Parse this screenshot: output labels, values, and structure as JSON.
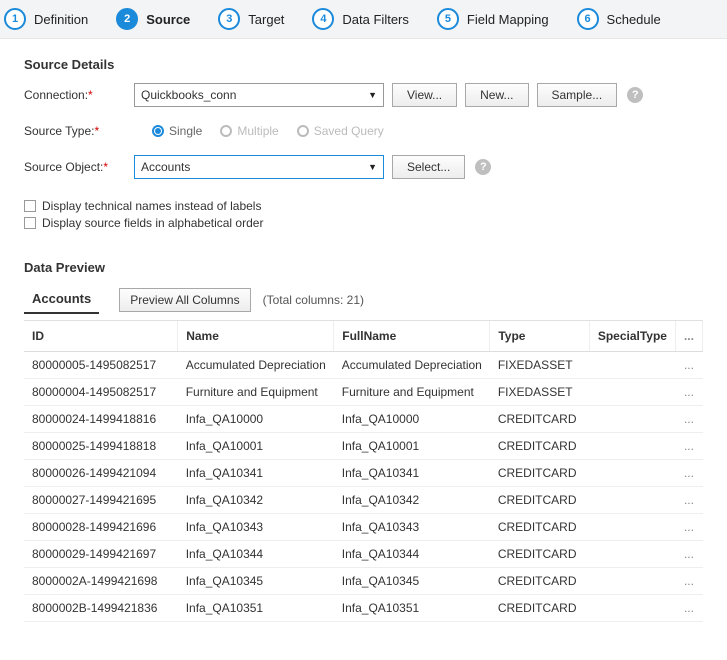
{
  "stepper": [
    {
      "num": "1",
      "label": "Definition"
    },
    {
      "num": "2",
      "label": "Source"
    },
    {
      "num": "3",
      "label": "Target"
    },
    {
      "num": "4",
      "label": "Data Filters"
    },
    {
      "num": "5",
      "label": "Field Mapping"
    },
    {
      "num": "6",
      "label": "Schedule"
    }
  ],
  "activeStep": 2,
  "sectionTitle": "Source Details",
  "labels": {
    "connection": "Connection:",
    "sourceType": "Source Type:",
    "sourceObject": "Source Object:"
  },
  "connection": {
    "value": "Quickbooks_conn"
  },
  "buttons": {
    "view": "View...",
    "new": "New...",
    "sample": "Sample...",
    "select": "Select...",
    "previewAll": "Preview All Columns"
  },
  "sourceType": {
    "options": [
      {
        "label": "Single",
        "checked": true,
        "disabled": false
      },
      {
        "label": "Multiple",
        "checked": false,
        "disabled": true
      },
      {
        "label": "Saved Query",
        "checked": false,
        "disabled": true
      }
    ]
  },
  "sourceObject": {
    "value": "Accounts"
  },
  "checkboxes": {
    "technical": "Display technical names instead of labels",
    "alphabetical": "Display source fields in alphabetical order"
  },
  "preview": {
    "title": "Data Preview",
    "tab": "Accounts",
    "totalColumns": "(Total columns: 21)",
    "columns": [
      "ID",
      "Name",
      "FullName",
      "Type",
      "SpecialType"
    ],
    "rows": [
      {
        "id": "80000005-1495082517",
        "name": "Accumulated Depreciation",
        "full": "Accumulated Depreciation",
        "type": "FIXEDASSET",
        "st": ""
      },
      {
        "id": "80000004-1495082517",
        "name": "Furniture and Equipment",
        "full": "Furniture and Equipment",
        "type": "FIXEDASSET",
        "st": ""
      },
      {
        "id": "80000024-1499418816",
        "name": "Infa_QA10000",
        "full": "Infa_QA10000",
        "type": "CREDITCARD",
        "st": ""
      },
      {
        "id": "80000025-1499418818",
        "name": "Infa_QA10001",
        "full": "Infa_QA10001",
        "type": "CREDITCARD",
        "st": ""
      },
      {
        "id": "80000026-1499421094",
        "name": "Infa_QA10341",
        "full": "Infa_QA10341",
        "type": "CREDITCARD",
        "st": ""
      },
      {
        "id": "80000027-1499421695",
        "name": "Infa_QA10342",
        "full": "Infa_QA10342",
        "type": "CREDITCARD",
        "st": ""
      },
      {
        "id": "80000028-1499421696",
        "name": "Infa_QA10343",
        "full": "Infa_QA10343",
        "type": "CREDITCARD",
        "st": ""
      },
      {
        "id": "80000029-1499421697",
        "name": "Infa_QA10344",
        "full": "Infa_QA10344",
        "type": "CREDITCARD",
        "st": ""
      },
      {
        "id": "8000002A-1499421698",
        "name": "Infa_QA10345",
        "full": "Infa_QA10345",
        "type": "CREDITCARD",
        "st": ""
      },
      {
        "id": "8000002B-1499421836",
        "name": "Infa_QA10351",
        "full": "Infa_QA10351",
        "type": "CREDITCARD",
        "st": ""
      }
    ]
  },
  "misc": {
    "ellipsis": "...",
    "asterisk": "*"
  }
}
